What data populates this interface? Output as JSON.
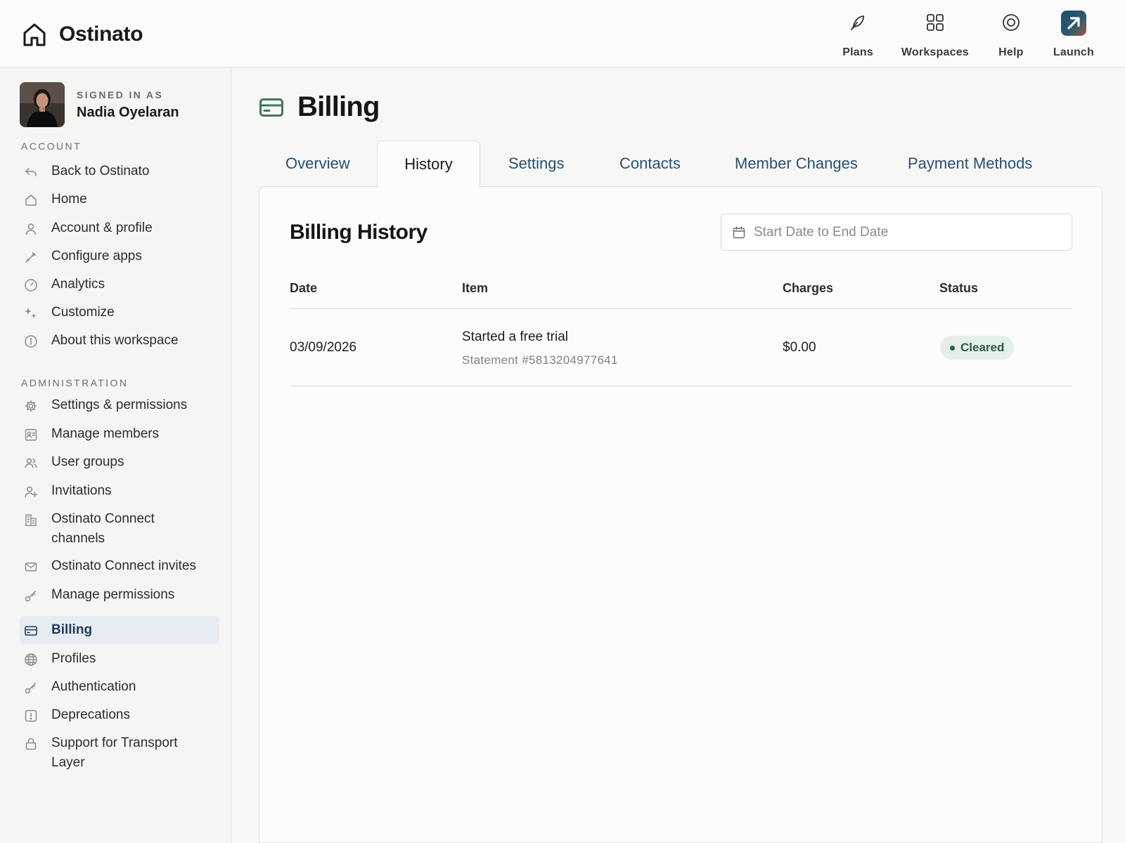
{
  "app": {
    "name": "Ostinato"
  },
  "topnav": [
    {
      "label": "Plans",
      "icon": "feather-icon"
    },
    {
      "label": "Workspaces",
      "icon": "grid-icon"
    },
    {
      "label": "Help",
      "icon": "help-ring-icon"
    },
    {
      "label": "Launch",
      "icon": "launch-arrow-icon"
    }
  ],
  "user": {
    "signed_in_label": "SIGNED IN AS",
    "name": "Nadia Oyelaran"
  },
  "sidebar": {
    "account_label": "ACCOUNT",
    "account_items": [
      {
        "label": "Back to Ostinato",
        "icon": "back-arrow-icon"
      },
      {
        "label": "Home",
        "icon": "home-icon"
      },
      {
        "label": "Account & profile",
        "icon": "person-icon"
      },
      {
        "label": "Configure apps",
        "icon": "wand-icon"
      },
      {
        "label": "Analytics",
        "icon": "gauge-icon"
      },
      {
        "label": "Customize",
        "icon": "sparkle-icon"
      },
      {
        "label": "About this workspace",
        "icon": "info-icon"
      }
    ],
    "admin_label": "ADMINISTRATION",
    "admin_items": [
      {
        "label": "Settings & permissions",
        "icon": "gear-icon"
      },
      {
        "label": "Manage members",
        "icon": "id-card-icon"
      },
      {
        "label": "User groups",
        "icon": "users-icon"
      },
      {
        "label": "Invitations",
        "icon": "person-add-icon"
      },
      {
        "label": "Ostinato Connect channels",
        "icon": "buildings-icon"
      },
      {
        "label": "Ostinato Connect invites",
        "icon": "envelope-icon"
      },
      {
        "label": "Manage permissions",
        "icon": "key-icon"
      },
      {
        "label": "Billing",
        "icon": "credit-card-icon",
        "active": true
      },
      {
        "label": "Profiles",
        "icon": "globe-icon"
      },
      {
        "label": "Authentication",
        "icon": "key-icon"
      },
      {
        "label": "Deprecations",
        "icon": "alert-square-icon"
      },
      {
        "label": "Support for Transport Layer",
        "icon": "lock-icon"
      }
    ]
  },
  "page": {
    "title": "Billing",
    "tabs": [
      "Overview",
      "History",
      "Settings",
      "Contacts",
      "Member Changes",
      "Payment Methods"
    ],
    "active_tab": "History"
  },
  "history": {
    "title": "Billing History",
    "date_placeholder": "Start Date to End Date",
    "columns": {
      "date": "Date",
      "item": "Item",
      "charges": "Charges",
      "status": "Status"
    },
    "rows": [
      {
        "date": "03/09/2026",
        "item": "Started a free trial",
        "statement": "Statement #5813204977641",
        "charges": "$0.00",
        "status": "Cleared"
      }
    ]
  },
  "colors": {
    "accent": "#27506f",
    "active_nav_bg": "#e7ecf2",
    "status_cleared_bg": "#e4efe8",
    "status_cleared_text": "#2e5c42",
    "billing_icon": "#3f7a55"
  }
}
